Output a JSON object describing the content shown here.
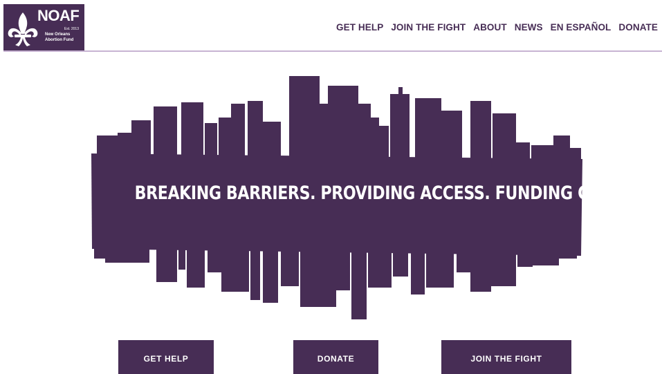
{
  "logo": {
    "abbr": "NOAF",
    "est": "Est. 2013",
    "name": "New Orleans Abortion Fund",
    "icon": "fleur-de-lis-icon"
  },
  "nav": {
    "items": [
      "GET HELP",
      "JOIN THE FIGHT",
      "ABOUT",
      "NEWS",
      "EN ESPAÑOL",
      "DONATE"
    ]
  },
  "hero": {
    "tagline": "BREAKING BARRIERS. PROVIDING ACCESS. FUNDING CHOICE.",
    "image": "city-skyline-reflection"
  },
  "cta": {
    "get_help": "GET HELP",
    "donate": "DONATE",
    "join_the_fight": "JOIN THE FIGHT"
  },
  "colors": {
    "brand_purple": "#472D55",
    "rule": "#C7B3D2",
    "background": "#FFFFFF"
  }
}
